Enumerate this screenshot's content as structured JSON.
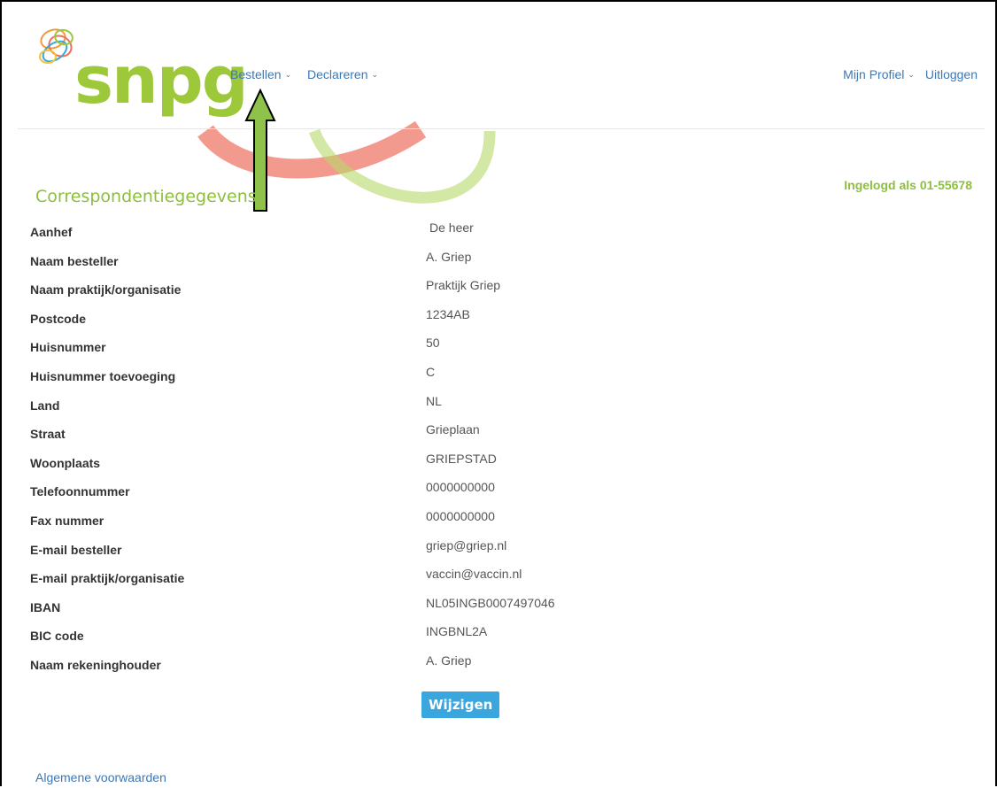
{
  "brand": {
    "logo_text": "snpg",
    "colors": {
      "green": "#9cc83a",
      "red": "#ee6f5f",
      "blue": "#3aa6de",
      "link": "#3d78b5"
    }
  },
  "nav": {
    "left": [
      {
        "label": "Bestellen",
        "icon": "chevron-down-icon"
      },
      {
        "label": "Declareren",
        "icon": "chevron-down-icon"
      }
    ],
    "right": {
      "profile": "Mijn Profiel",
      "logout": "Uitloggen"
    }
  },
  "page": {
    "title": "Correspondentiegegevens",
    "logged_in": "Ingelogd als 01-55678"
  },
  "details": [
    {
      "label": "Aanhef",
      "value": "De heer"
    },
    {
      "label": "Naam besteller",
      "value": "A. Griep"
    },
    {
      "label": "Naam praktijk/organisatie",
      "value": "Praktijk Griep"
    },
    {
      "label": "Postcode",
      "value": "1234AB"
    },
    {
      "label": "Huisnummer",
      "value": "50"
    },
    {
      "label": "Huisnummer toevoeging",
      "value": "C"
    },
    {
      "label": "Land",
      "value": "NL"
    },
    {
      "label": "Straat",
      "value": "Grieplaan"
    },
    {
      "label": "Woonplaats",
      "value": "GRIEPSTAD"
    },
    {
      "label": "Telefoonnummer",
      "value": "0000000000"
    },
    {
      "label": "Fax nummer",
      "value": "0000000000"
    },
    {
      "label": "E-mail besteller",
      "value": "griep@griep.nl"
    },
    {
      "label": "E-mail praktijk/organisatie",
      "value": "vaccin@vaccin.nl"
    },
    {
      "label": "IBAN",
      "value": "NL05INGB0007497046"
    },
    {
      "label": "BIC code",
      "value": "INGBNL2A"
    },
    {
      "label": "Naam rekeninghouder",
      "value": "A. Griep"
    }
  ],
  "actions": {
    "edit": "Wijzigen"
  },
  "footer": {
    "terms": "Algemene voorwaarden"
  }
}
